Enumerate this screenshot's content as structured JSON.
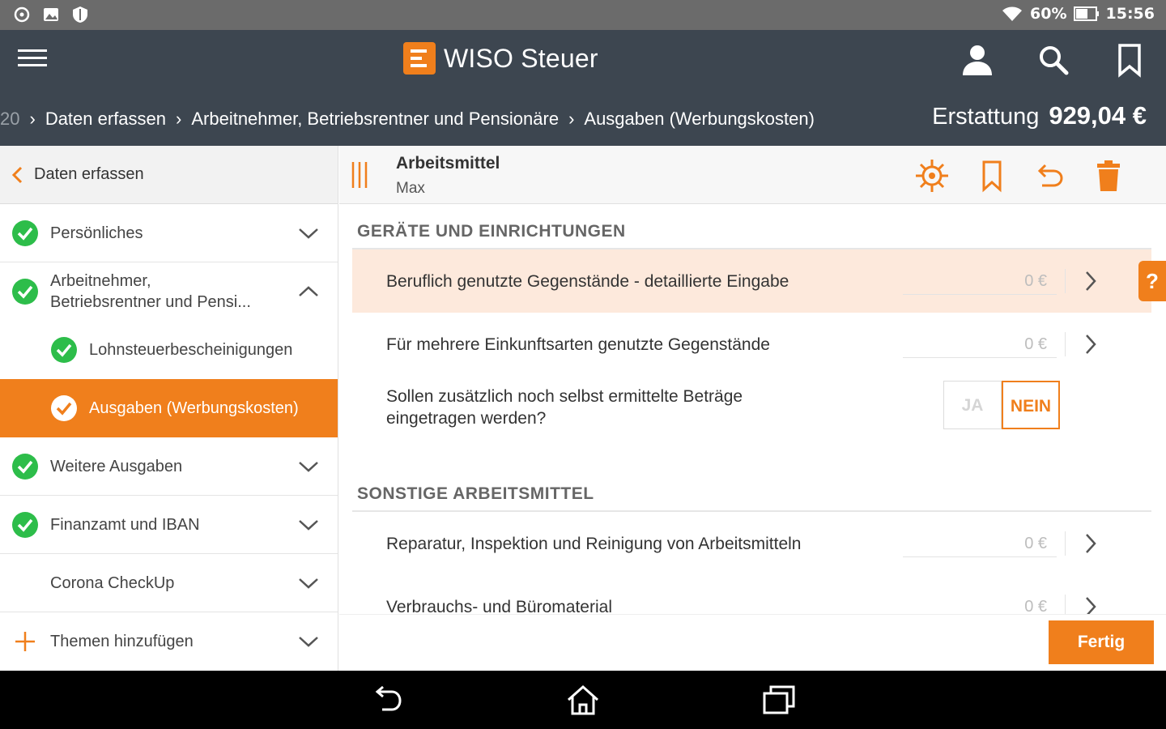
{
  "status_bar": {
    "battery": "60%",
    "time": "15:56"
  },
  "app_bar": {
    "title": "WISO Steuer",
    "icons": [
      "menu-icon",
      "user-icon",
      "search-icon",
      "bookmark-icon"
    ]
  },
  "breadcrumb": {
    "prefix": "20",
    "items": [
      "Daten erfassen",
      "Arbeitnehmer, Betriebsrentner und Pensionäre",
      "Ausgaben (Werbungskosten)"
    ]
  },
  "refund": {
    "label": "Erstattung",
    "value": "929,04 €"
  },
  "sidebar": {
    "back_label": "Daten erfassen",
    "items": [
      {
        "label": "Persönliches"
      },
      {
        "label_line1": "Arbeitnehmer,",
        "label_line2": "Betriebsrentner und Pensi..."
      },
      {
        "label": "Lohnsteuerbescheinigungen"
      },
      {
        "label": "Ausgaben (Werbungskosten)"
      },
      {
        "label": "Weitere Ausgaben"
      },
      {
        "label": "Finanzamt und IBAN"
      },
      {
        "label": "Corona CheckUp"
      },
      {
        "label": "Themen hinzufügen"
      }
    ]
  },
  "main": {
    "title": "Arbeitsmittel",
    "subtitle": "Max",
    "section1": "GERÄTE UND EINRICHTUNGEN",
    "rows1": [
      {
        "label": "Beruflich genutzte Gegenstände - detaillierte Eingabe",
        "amount": "0 €"
      },
      {
        "label": "Für mehrere Einkunftsarten genutzte Gegenstände",
        "amount": "0 €"
      }
    ],
    "question_line1": "Sollen zusätzlich noch selbst ermittelte Beträge",
    "question_line2": "eingetragen werden?",
    "toggle_yes": "JA",
    "toggle_no": "NEIN",
    "toggle_selected": "NEIN",
    "section2": "SONSTIGE ARBEITSMITTEL",
    "rows2": [
      {
        "label": "Reparatur, Inspektion und Reinigung von Arbeitsmitteln",
        "amount": "0 €"
      },
      {
        "label": "Verbrauchs- und Büromaterial",
        "amount": "0 €"
      }
    ],
    "help": "?",
    "done_button": "Fertig"
  },
  "colors": {
    "accent": "#f07f1c",
    "appbar": "#3d4650",
    "check_green": "#2dbd4a",
    "highlight_row": "#fde9dc"
  }
}
